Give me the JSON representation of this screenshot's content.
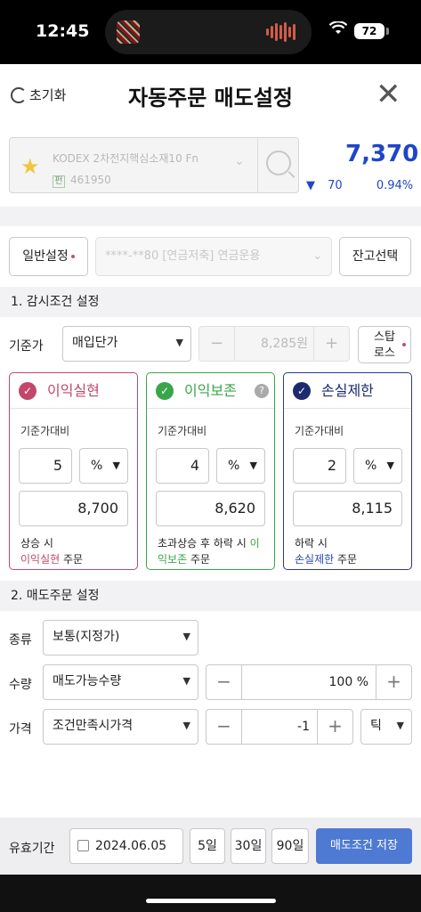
{
  "status": {
    "time": "12:45",
    "battery": "72"
  },
  "header": {
    "reset_label": "초기화",
    "title": "자동주문 매도설정",
    "close_label": "✕"
  },
  "stock": {
    "name": "KODEX 2차전지핵심소재10 Fn",
    "code_badge": "펀",
    "code": "461950",
    "price": "7,370",
    "change_arrow": "▼",
    "change_value": "70",
    "change_rate": "0.94%"
  },
  "account": {
    "general_label": "일반설정",
    "account_value": "****-**80 [연금저축] 연금운용",
    "balance_button": "잔고선택"
  },
  "monitor": {
    "section_title": "1. 감시조건 설정",
    "base_label": "기준가",
    "base_select": "매입단가",
    "base_price": "8,285원",
    "minus": "−",
    "plus": "+",
    "stop_line1": "스탑",
    "stop_line2": "로스"
  },
  "cards": [
    {
      "title": "이익실현",
      "sub": "기준가대비",
      "percent": "5",
      "unit": "%",
      "price": "8,700",
      "desc_line1": "상승 시",
      "desc_highlight": "이익실현",
      "desc_tail": " 주문",
      "color": "#c2476b"
    },
    {
      "title": "이익보존",
      "sub": "기준가대비",
      "percent": "4",
      "unit": "%",
      "price": "8,620",
      "desc_line1": "초과상승 후 하락 시",
      "desc_highlight_a": "이",
      "desc_highlight_b": "익보존",
      "desc_tail": " 주문",
      "help": "?",
      "color": "#3aa64a"
    },
    {
      "title": "손실제한",
      "sub": "기준가대비",
      "percent": "2",
      "unit": "%",
      "price": "8,115",
      "desc_line1": "하락 시",
      "desc_highlight": "손실제한",
      "desc_tail": " 주문",
      "color": "#2a3a8e"
    }
  ],
  "sell": {
    "section_title": "2. 매도주문 설정",
    "type_label": "종류",
    "type_select": "보통(지정가)",
    "qty_label": "수량",
    "qty_select": "매도가능수량",
    "qty_value": "100 %",
    "price_label": "가격",
    "price_select": "조건만족시가격",
    "price_value": "-1",
    "tick_select": "틱",
    "minus": "−",
    "plus": "+"
  },
  "footer": {
    "validity_label": "유효기간",
    "date": "2024.06.05",
    "day5": "5일",
    "day30": "30일",
    "day90": "90일",
    "save": "매도조건 저장"
  }
}
